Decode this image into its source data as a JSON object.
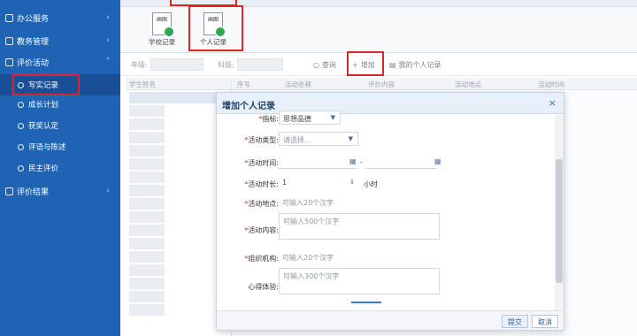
{
  "sidebar": {
    "items": [
      {
        "label": "办公服务",
        "icon": "grid-icon",
        "chevron": "‹"
      },
      {
        "label": "教务管理",
        "icon": "grid-icon",
        "chevron": "‹"
      },
      {
        "label": "评价活动",
        "icon": "grid-icon",
        "chevron": "˅"
      },
      {
        "label": "评价结果",
        "icon": "grid-icon",
        "chevron": "‹"
      }
    ],
    "sub_items": [
      {
        "label": "写实记录"
      },
      {
        "label": "成长计划"
      },
      {
        "label": "获奖认定"
      },
      {
        "label": "评语与陈述"
      },
      {
        "label": "民主评价"
      }
    ]
  },
  "toolbar": {
    "buttons": [
      {
        "label": "学校记录",
        "icon_text": "画图"
      },
      {
        "label": "个人记录",
        "icon_text": "画图"
      }
    ]
  },
  "filterbar": {
    "year_label": "年级:",
    "type_label": "科级:",
    "query_label": "查询",
    "add_label": "增加",
    "mine_label": "我的个人记录"
  },
  "grid": {
    "left_header": "学生姓名",
    "headers": [
      "序号",
      "活动名称",
      "评价内容",
      "活动地点",
      "活动时间"
    ]
  },
  "modal": {
    "title": "增加个人记录",
    "close": "×",
    "fields": [
      {
        "label": "指标:",
        "value": "思想品德",
        "required": true
      },
      {
        "label": "活动类型:",
        "value": "请选择...",
        "required": true
      },
      {
        "label": "活动时间:",
        "value": "",
        "separator": "-",
        "required": true
      },
      {
        "label": "活动时长:",
        "value": "1",
        "unit": "小时",
        "required": true
      },
      {
        "label": "活动地点:",
        "placeholder": "可输入20个汉字",
        "required": true
      },
      {
        "label": "活动内容:",
        "placeholder": "可输入500个汉字",
        "required": true
      },
      {
        "label": "组织机构:",
        "placeholder": "可输入20个汉字",
        "required": true
      },
      {
        "label": "心得体验:",
        "placeholder": "可输入300个汉字",
        "required": false
      }
    ],
    "submit_label": "提交",
    "cancel_label": "取消"
  },
  "colors": {
    "sidebar_bg": "#1e63b4",
    "highlight": "#d9262c",
    "accent": "#2c6fc4"
  }
}
